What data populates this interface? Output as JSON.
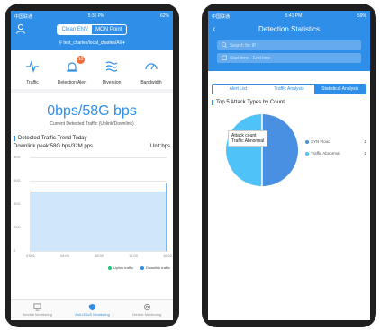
{
  "left": {
    "status": {
      "left": "中国联通",
      "time": "5:36 PM",
      "right": "62%"
    },
    "env_tabs": [
      "Clean ENV",
      "MON Point"
    ],
    "location": "test_charles/local_charles/All ▾",
    "functions": [
      {
        "label": "Traffic",
        "icon": "pulse-icon"
      },
      {
        "label": "Detection Alert",
        "icon": "alarm-icon",
        "badge": "10"
      },
      {
        "label": "Diversion",
        "icon": "waves-icon"
      },
      {
        "label": "Bandwidth",
        "icon": "gauge-icon"
      }
    ],
    "current": {
      "value": "0bps/58G bps",
      "caption": "Current Detected Traffic (Uplink/Downlink)"
    },
    "trend": {
      "title": "Detected Traffic Trend Today",
      "peak": "Downlink peak:58G bps/32M pps",
      "unit": "Unit:bps"
    },
    "tabbar": [
      {
        "label": "Service Monitoring",
        "icon": "monitor-icon"
      },
      {
        "label": "Anti-DDoS Monitoring",
        "icon": "shield-icon"
      },
      {
        "label": "Device Monitoring",
        "icon": "gear-icon"
      }
    ]
  },
  "chart_data": {
    "type": "area",
    "title": "Detected Traffic Trend Today",
    "yticks": [
      "80G",
      "60G",
      "40G",
      "20G",
      "0"
    ],
    "ylim": [
      0,
      80
    ],
    "x": [
      "03/01",
      "04:00",
      "08:00",
      "12:00",
      "16:00"
    ],
    "series": [
      {
        "name": "Uplink traffic",
        "color": "#27c27a",
        "values": [
          0,
          0,
          0,
          0,
          0
        ]
      },
      {
        "name": "Downlink traffic",
        "color": "#2f8fe8",
        "values": [
          50,
          50,
          50,
          50,
          58
        ]
      }
    ]
  },
  "right": {
    "status": {
      "left": "中国联通",
      "time": "5:41 PM",
      "right": "59%"
    },
    "title": "Detection Statistics",
    "search_placeholder": "Search for IP",
    "time_placeholder": "Start time - End time",
    "tabs": [
      "Alert List",
      "Traffic Analysis",
      "Statistical Analysis"
    ],
    "section_title": "Top 5 Attack Types by Count",
    "tooltip": {
      "line1": "Attack count",
      "line2": "Traffic Abnormal"
    },
    "pie": [
      {
        "label": "SYN Flood",
        "value": 2,
        "color": "#4a90e2"
      },
      {
        "label": "Traffic Abnormal",
        "value": 2,
        "color": "#4fc3f7"
      }
    ]
  }
}
